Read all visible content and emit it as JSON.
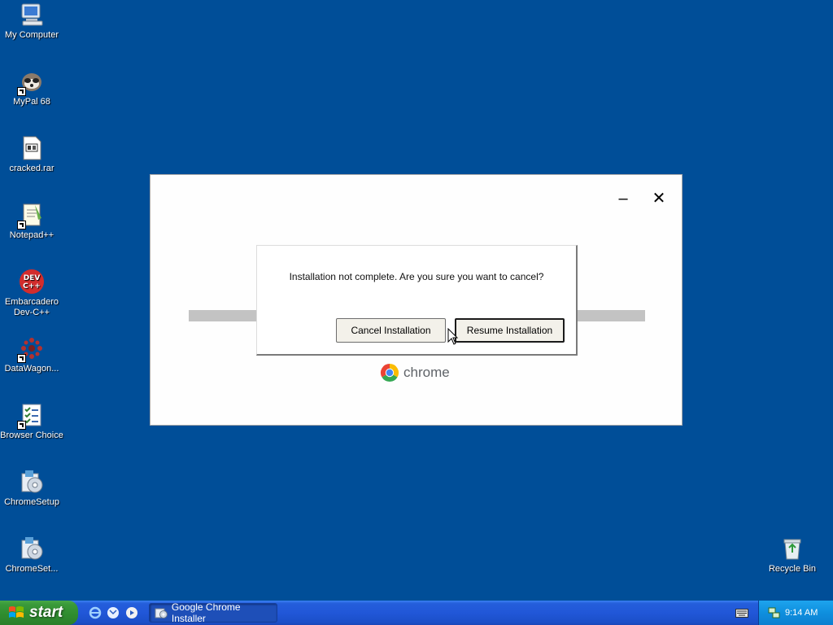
{
  "desktop": {
    "icons": [
      {
        "label": "My Computer"
      },
      {
        "label": "MyPal 68"
      },
      {
        "label": "cracked.rar"
      },
      {
        "label": "Notepad++"
      },
      {
        "label": "Embarcadero Dev-C++"
      },
      {
        "label": "DataWagon..."
      },
      {
        "label": "Browser Choice"
      },
      {
        "label": "ChromeSetup"
      },
      {
        "label": "ChromeSet..."
      },
      {
        "label": "Recycle Bin"
      }
    ]
  },
  "installer": {
    "minimize_label": "–",
    "close_label": "✕",
    "brand": "chrome",
    "dialog": {
      "message": "Installation not complete. Are you sure you want to cancel?",
      "cancel_label": "Cancel Installation",
      "resume_label": "Resume Installation"
    }
  },
  "taskbar": {
    "start_label": "start",
    "task_item_label": "Google Chrome Installer",
    "clock": "9:14 AM"
  },
  "colors": {
    "desktop_bg": "#004e98",
    "taskbar": "#245edb",
    "start": "#3a9a3a",
    "tray": "#0f8fde"
  }
}
